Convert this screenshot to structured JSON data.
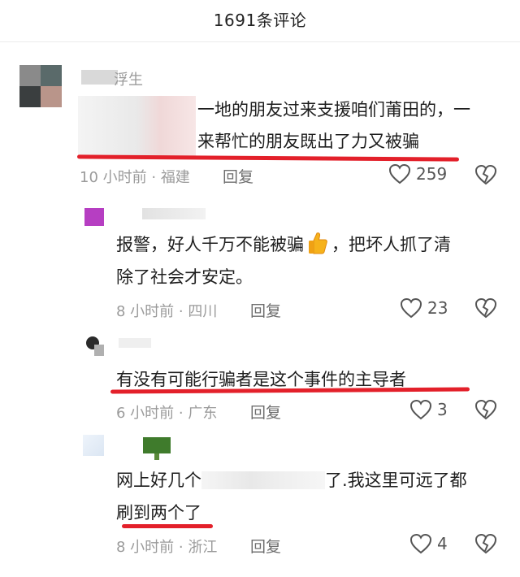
{
  "header": {
    "title": "1691条评论"
  },
  "comments": [
    {
      "username": "浮生",
      "lines": [
        "一地的朋友过来支援咱们莆田的，一",
        "来帮忙的朋友既出了力又被骗"
      ],
      "time": "10 小时前",
      "location": "福建",
      "reply_label": "回复",
      "likes": "259"
    },
    {
      "username": "",
      "line1_before": "报警，好人千万不能被骗",
      "line1_after": "，把坏人抓了清",
      "line2": "除了社会才安定。",
      "emoji": "thumbs-up-emoji",
      "time": "8 小时前",
      "location": "四川",
      "reply_label": "回复",
      "likes": "23"
    },
    {
      "username": "",
      "lines": [
        "有没有可能行骗者是这个事件的主导者"
      ],
      "time": "6 小时前",
      "location": "广东",
      "reply_label": "回复",
      "likes": "3"
    },
    {
      "username": "",
      "line1_before": "网上好几个",
      "line1_after": "了.我这里可远了都",
      "line2": "刷到两个了",
      "time": "8 小时前",
      "location": "浙江",
      "reply_label": "回复",
      "likes": "4"
    }
  ],
  "colors": {
    "highlight_red": "#e3202a",
    "meta_gray": "#9b9b9b"
  },
  "icons": [
    "heart-outline-icon",
    "broken-heart-icon"
  ]
}
